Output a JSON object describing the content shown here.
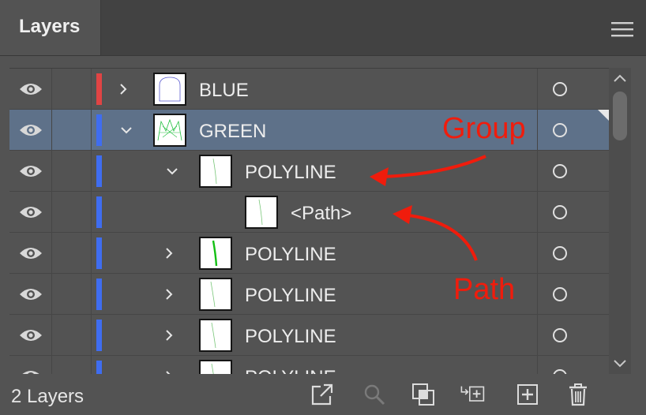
{
  "panel": {
    "tab_label": "Layers",
    "menu_icon": "hamburger-menu-icon"
  },
  "rows": [
    {
      "name": "BLUE",
      "color": "#e04444",
      "expanded": false,
      "visible": true,
      "selected": false
    },
    {
      "name": "GREEN",
      "color": "#3f6df0",
      "expanded": true,
      "visible": true,
      "selected": true
    },
    {
      "name": "POLYLINE",
      "color": "#3f6df0",
      "expanded": true,
      "visible": true,
      "selected": false
    },
    {
      "name": "<Path>",
      "color": "#3f6df0",
      "expanded": false,
      "visible": true,
      "selected": false
    },
    {
      "name": "POLYLINE",
      "color": "#3f6df0",
      "expanded": false,
      "visible": true,
      "selected": false
    },
    {
      "name": "POLYLINE",
      "color": "#3f6df0",
      "expanded": false,
      "visible": true,
      "selected": false
    },
    {
      "name": "POLYLINE",
      "color": "#3f6df0",
      "expanded": false,
      "visible": true,
      "selected": false
    },
    {
      "name": "POLYLINE",
      "color": "#3f6df0",
      "expanded": false,
      "visible": true,
      "selected": false
    }
  ],
  "footer": {
    "layer_count": "2 Layers",
    "tools": [
      "export-icon",
      "search-icon",
      "clipping-mask-icon",
      "create-sublayer-icon",
      "new-layer-icon",
      "trash-icon"
    ]
  },
  "annotations": {
    "group_label": "Group",
    "path_label": "Path",
    "color": "#f01c0c"
  }
}
